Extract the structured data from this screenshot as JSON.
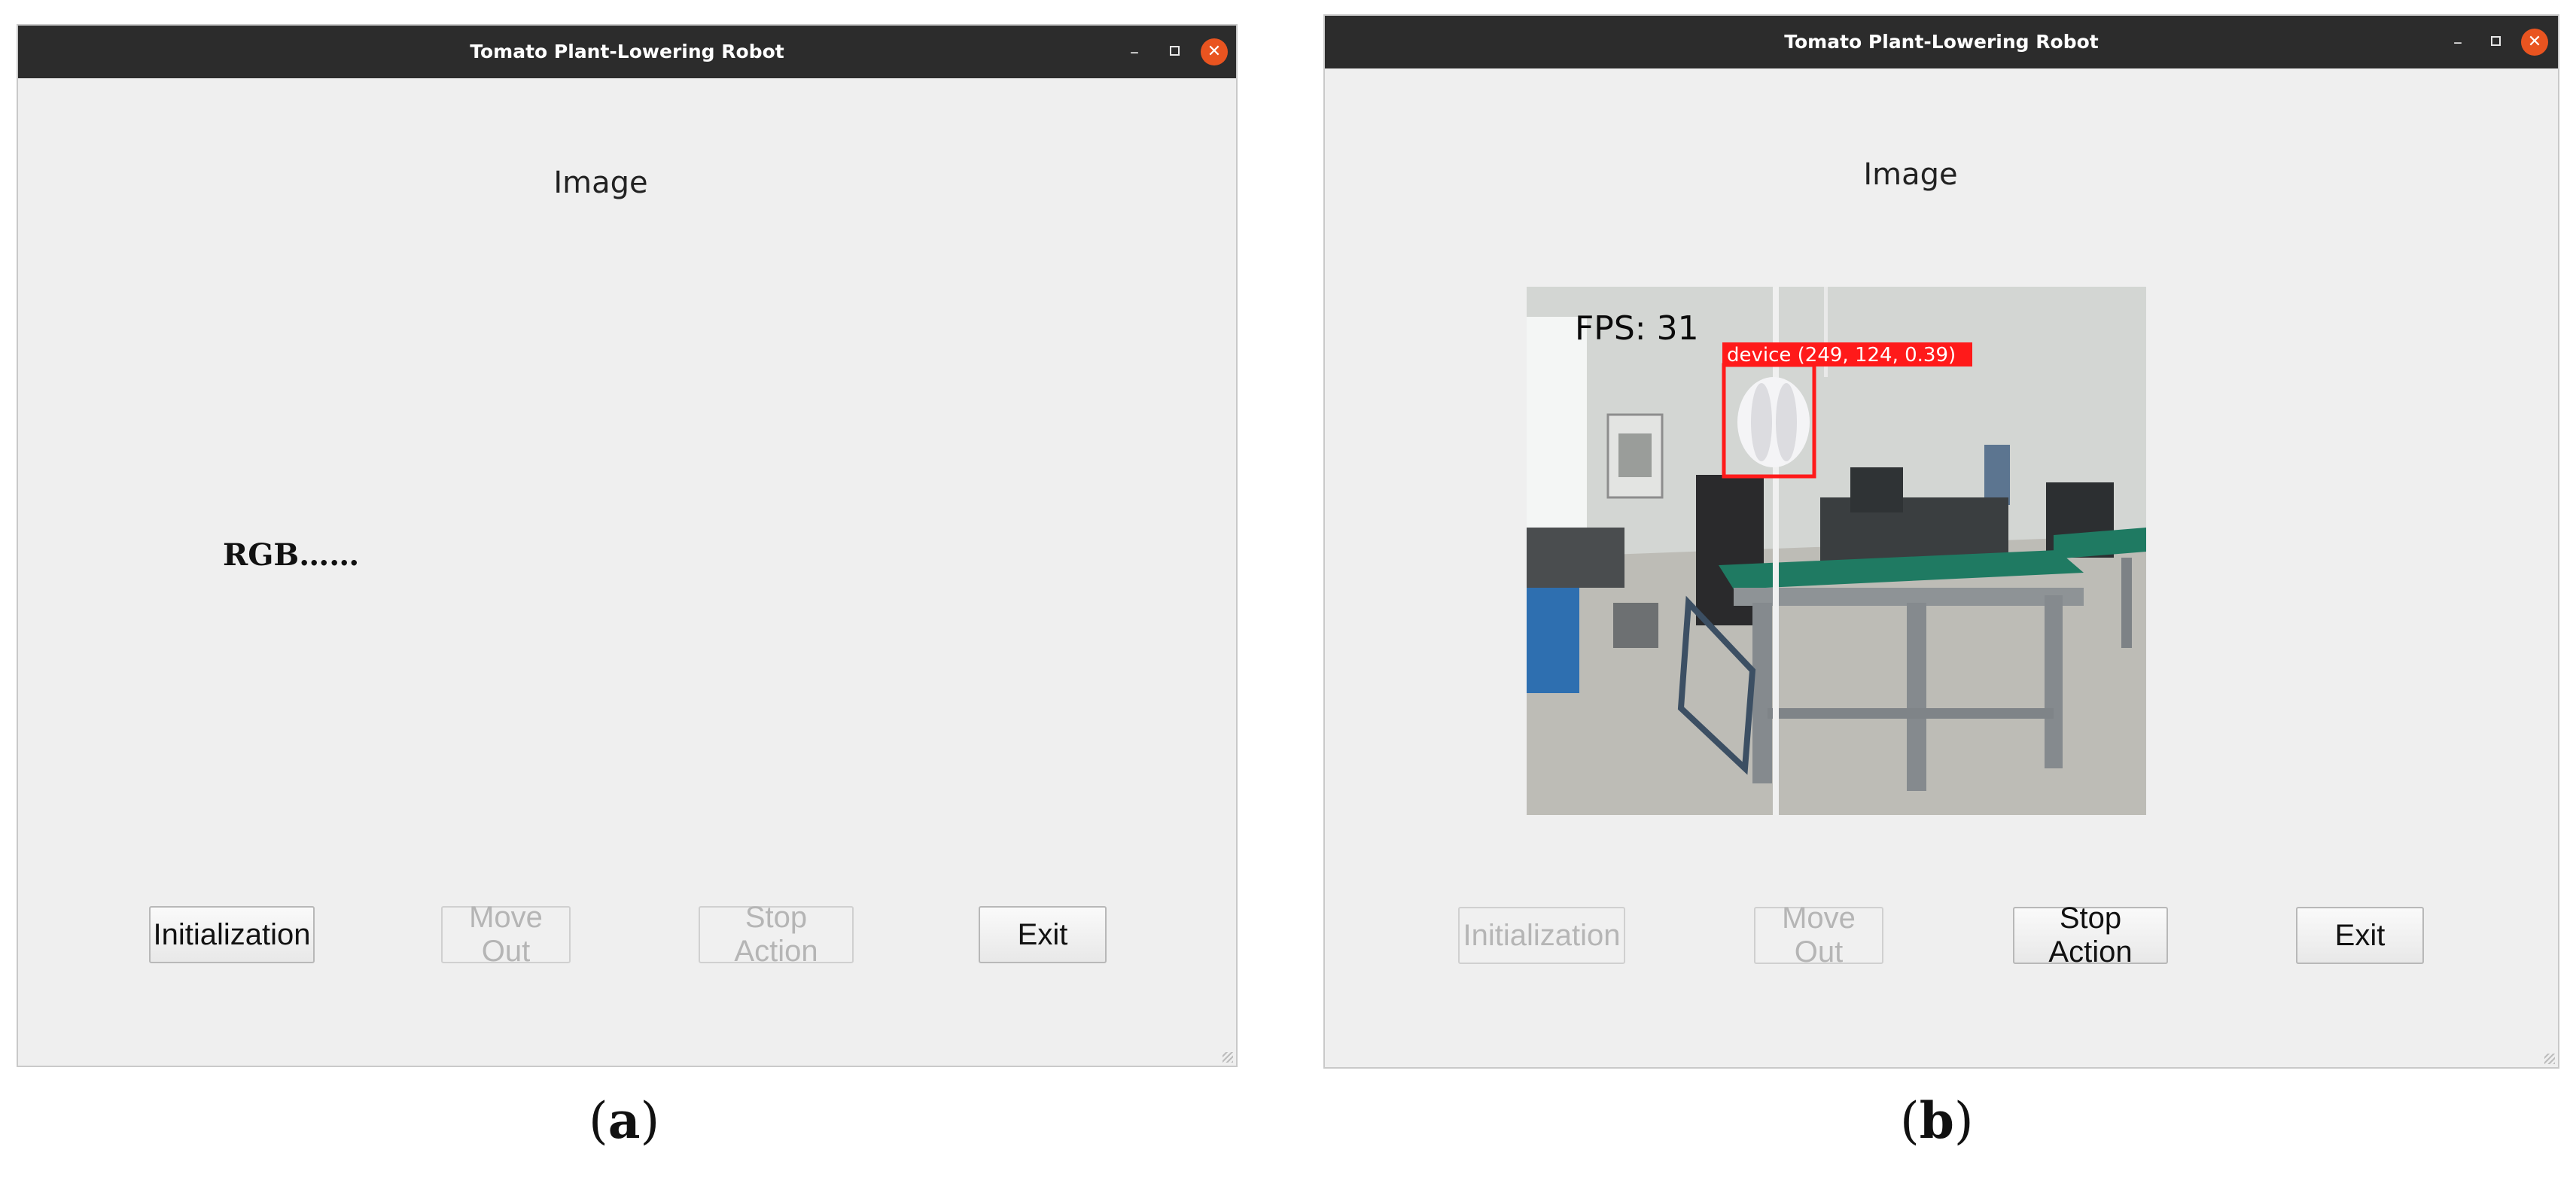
{
  "window_a": {
    "title": "Tomato Plant-Lowering Robot",
    "minimize": "–",
    "close": "✕",
    "image_label": "Image",
    "placeholder_text": "RGB……",
    "buttons": {
      "initialization": "Initialization",
      "move_out": "Move Out",
      "stop_action": "Stop Action",
      "exit": "Exit"
    }
  },
  "window_b": {
    "title": "Tomato Plant-Lowering Robot",
    "minimize": "–",
    "close": "✕",
    "image_label": "Image",
    "fps_label": "FPS:  31",
    "detection_label": "device (249, 124, 0.39)",
    "buttons": {
      "initialization": "Initialization",
      "move_out": "Move Out",
      "stop_action": "Stop Action",
      "exit": "Exit"
    }
  },
  "captions": {
    "a_open": "(",
    "a_letter": "a",
    "a_close": ")",
    "b_open": "(",
    "b_letter": "b",
    "b_close": ")"
  },
  "colors": {
    "titlebar": "#2c2c2c",
    "close_button": "#e95420",
    "window_bg": "#efefef",
    "detection_box": "#ff1a1a",
    "table_top": "#1f7a62"
  }
}
